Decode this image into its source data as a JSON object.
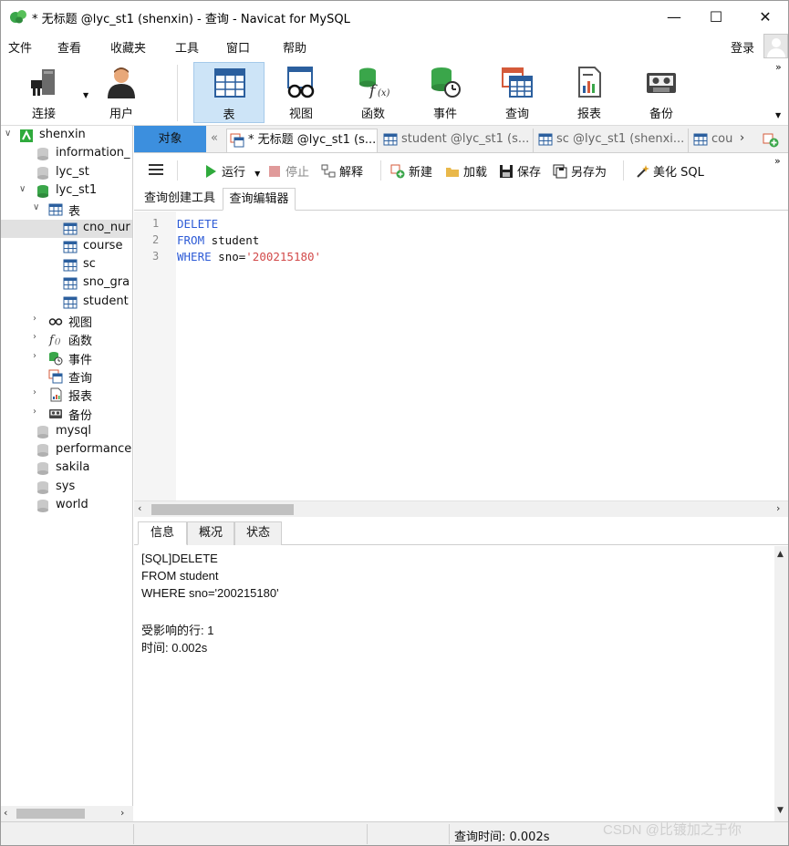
{
  "window": {
    "title": "* 无标题 @lyc_st1 (shenxin) - 查询 - Navicat for MySQL",
    "controls": {
      "minimize": "—",
      "maximize": "☐",
      "close": "✕"
    }
  },
  "menu": {
    "items": [
      "文件",
      "查看",
      "收藏夹",
      "工具",
      "窗口",
      "帮助"
    ],
    "login": "登录"
  },
  "toolbar": {
    "buttons": [
      {
        "label": "连接",
        "icon": "plug-icon"
      },
      {
        "label": "用户",
        "icon": "user-icon"
      },
      {
        "label": "表",
        "icon": "table-icon"
      },
      {
        "label": "视图",
        "icon": "view-glasses-icon"
      },
      {
        "label": "函数",
        "icon": "function-icon"
      },
      {
        "label": "事件",
        "icon": "event-clock-icon"
      },
      {
        "label": "查询",
        "icon": "query-icon"
      },
      {
        "label": "报表",
        "icon": "report-icon"
      },
      {
        "label": "备份",
        "icon": "backup-tape-icon"
      }
    ],
    "active": "表",
    "more": "»"
  },
  "tree": {
    "rows": [
      {
        "label": "shenxin",
        "icon": "connection-icon",
        "expander": "∨",
        "indent": 0
      },
      {
        "label": "information_",
        "icon": "database-icon",
        "indent": 1
      },
      {
        "label": "lyc_st",
        "icon": "database-icon",
        "indent": 1
      },
      {
        "label": "lyc_st1",
        "icon": "database-open-icon",
        "expander": "∨",
        "indent": 1
      },
      {
        "label": "表",
        "icon": "table-icon",
        "expander": "∨",
        "indent": 2
      },
      {
        "label": "cno_nur",
        "icon": "table-icon",
        "indent": 3,
        "selected": true
      },
      {
        "label": "course",
        "icon": "table-icon",
        "indent": 3
      },
      {
        "label": "sc",
        "icon": "table-icon",
        "indent": 3
      },
      {
        "label": "sno_gra",
        "icon": "table-icon",
        "indent": 3
      },
      {
        "label": "student",
        "icon": "table-icon",
        "indent": 3
      },
      {
        "label": "视图",
        "icon": "view-glasses-icon",
        "expander": "›",
        "indent": 2
      },
      {
        "label": "函数",
        "icon": "function-icon",
        "expander": "›",
        "indent": 2
      },
      {
        "label": "事件",
        "icon": "event-clock-icon",
        "expander": "›",
        "indent": 2
      },
      {
        "label": "查询",
        "icon": "query-icon",
        "indent": 2
      },
      {
        "label": "报表",
        "icon": "report-icon",
        "expander": "›",
        "indent": 2
      },
      {
        "label": "备份",
        "icon": "backup-tape-icon",
        "expander": "›",
        "indent": 2
      },
      {
        "label": "mysql",
        "icon": "database-icon",
        "indent": 1
      },
      {
        "label": "performance",
        "icon": "database-icon",
        "indent": 1
      },
      {
        "label": "sakila",
        "icon": "database-icon",
        "indent": 1
      },
      {
        "label": "sys",
        "icon": "database-icon",
        "indent": 1
      },
      {
        "label": "world",
        "icon": "database-icon",
        "indent": 1
      }
    ]
  },
  "tabs": {
    "objects": "对象",
    "docs": [
      {
        "label": "* 无标题 @lyc_st1 (s...",
        "icon": "query-icon",
        "active": true
      },
      {
        "label": "student @lyc_st1 (s...",
        "icon": "table-icon"
      },
      {
        "label": "sc @lyc_st1 (shenxi...",
        "icon": "table-icon"
      },
      {
        "label": "cou",
        "icon": "table-icon"
      }
    ],
    "nav_left": "«",
    "nav_right": "›"
  },
  "query_toolbar": {
    "run": "运行",
    "stop": "停止",
    "explain": "解释",
    "new": "新建",
    "load": "加载",
    "save": "保存",
    "save_as": "另存为",
    "beautify": "美化 SQL",
    "more": "»"
  },
  "subtabs": [
    "查询创建工具",
    "查询编辑器"
  ],
  "editor": {
    "lines": [
      {
        "num": "1",
        "kw": "DELETE",
        "rest": "",
        "str": ""
      },
      {
        "num": "2",
        "kw": "FROM",
        "rest": " student",
        "str": ""
      },
      {
        "num": "3",
        "kw": "WHERE",
        "rest": " sno=",
        "str": "'200215180'"
      }
    ]
  },
  "result_tabs": [
    "信息",
    "概况",
    "状态"
  ],
  "output": {
    "lines": [
      "[SQL]DELETE",
      "FROM student",
      "WHERE sno='200215180'",
      "",
      "受影响的行: 1",
      "时间: 0.002s"
    ]
  },
  "statusbar": {
    "query_time": "查询时间: 0.002s"
  },
  "watermark": "CSDN @比镀加之于你",
  "colors": {
    "accent_tab": "#3c8fde",
    "active_toolbar": "#cde4f7",
    "keyword": "#2d5bd6",
    "string": "#d24a4a"
  }
}
